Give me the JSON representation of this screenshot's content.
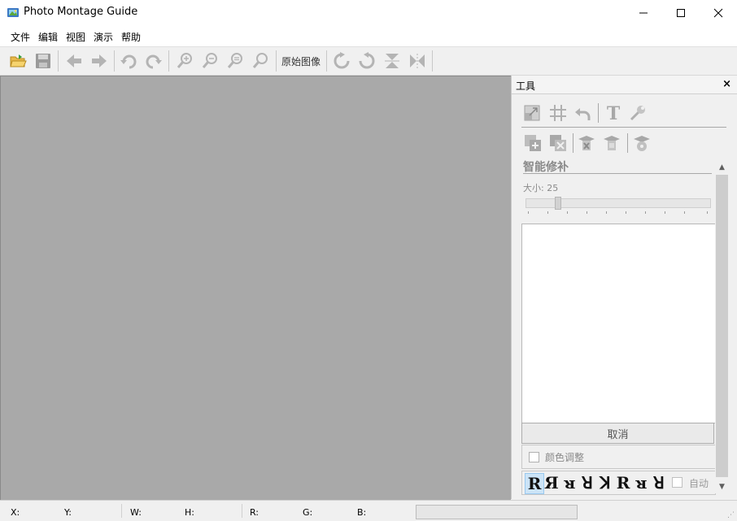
{
  "window": {
    "title": "Photo Montage Guide"
  },
  "menu": [
    "文件",
    "编辑",
    "视图",
    "演示",
    "帮助"
  ],
  "toolbar": {
    "original_image_label": "原始图像",
    "icons": [
      "open-folder-icon",
      "save-icon",
      "back-arrow-icon",
      "forward-arrow-icon",
      "undo-icon",
      "redo-icon",
      "zoom-in-icon",
      "zoom-out-icon",
      "zoom-fit-icon",
      "zoom-actual-icon",
      "rotate-right-icon",
      "rotate-left-icon",
      "flip-vertical-icon",
      "flip-horizontal-icon"
    ]
  },
  "panel": {
    "title": "工具",
    "close": "×",
    "smart_repair": "智能修补",
    "size_label": "大小: 25",
    "size_value": 25,
    "cancel": "取消",
    "color_adjust": "颜色调整",
    "auto": "自动",
    "orientation_glyphs": [
      "R",
      "Я",
      "ᴚ",
      "ꓤ",
      "ꓘ",
      "R",
      "ᴚ",
      "ꓤ"
    ],
    "scroll_up": "▲",
    "scroll_down": "▼"
  },
  "statusbar": {
    "x": "X:",
    "y": "Y:",
    "w": "W:",
    "h": "H:",
    "r": "R:",
    "g": "G:",
    "b": "B:"
  },
  "colors": {
    "canvas": "#a9a9a9",
    "selected": "#cce4f7"
  }
}
